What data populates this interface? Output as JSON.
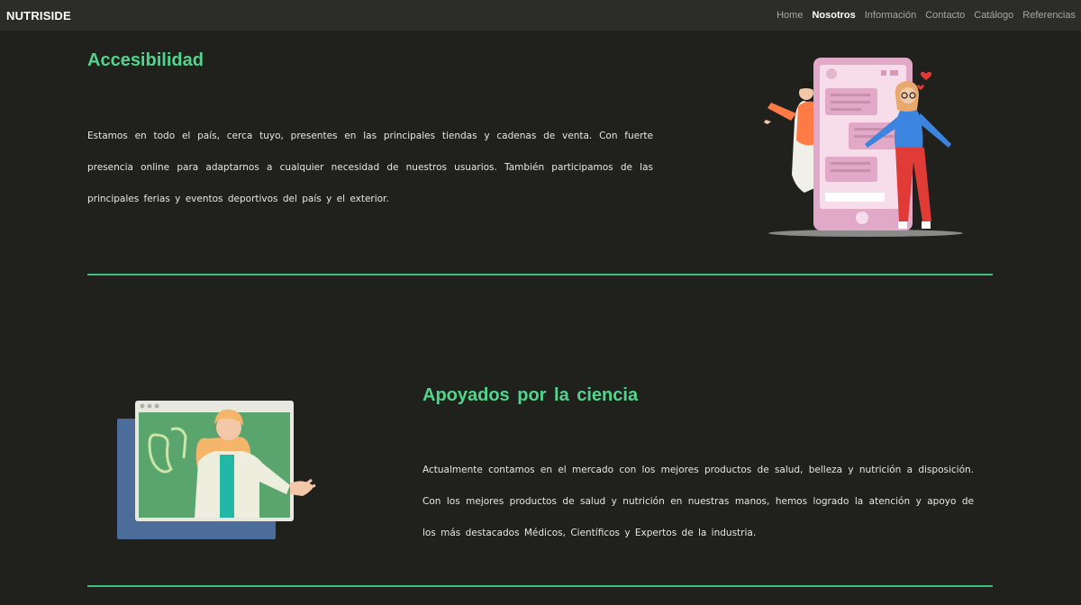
{
  "brand": "NUTRISIDE",
  "nav": {
    "items": [
      {
        "label": "Home"
      },
      {
        "label": "Nosotros"
      },
      {
        "label": "Información"
      },
      {
        "label": "Contacto"
      },
      {
        "label": "Catálogo"
      },
      {
        "label": "Referencias"
      }
    ],
    "active": "Nosotros"
  },
  "sections": [
    {
      "title": "Accesibilidad",
      "text": "Estamos en todo el país, cerca tuyo, presentes en las principales tiendas y cadenas de venta. Con fuerte presencia online para adaptarnos a cualquier necesidad de nuestros usuarios. También participamos de las principales ferias y eventos deportivos del país y el exterior."
    },
    {
      "title": "Apoyados por la ciencia",
      "text": "Actualmente contamos en el mercado con los mejores productos de salud, belleza y nutrición a disposición. Con los mejores productos de salud y nutrición en nuestras manos, hemos logrado la atención y apoyo de los más destacados Médicos, Científicos y Expertos de la industria."
    }
  ],
  "colors": {
    "accent": "#4fd68c",
    "background": "#20201d",
    "navbar": "#2c2c2a"
  }
}
